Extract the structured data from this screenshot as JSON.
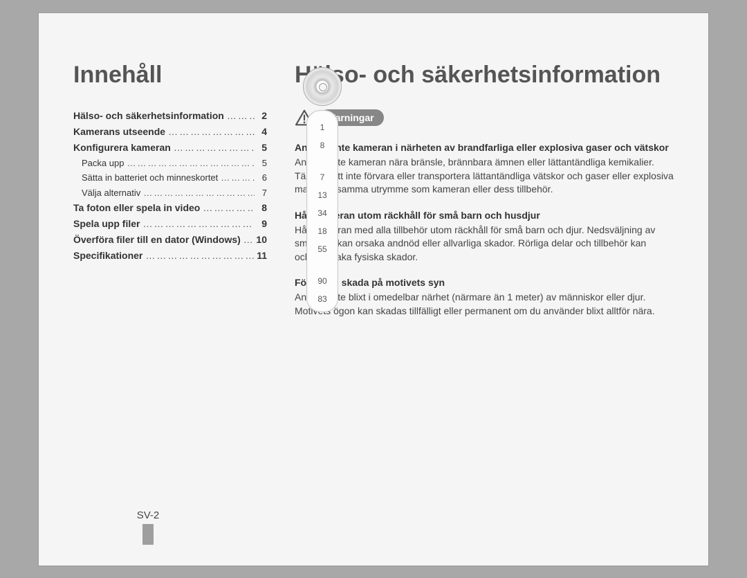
{
  "left": {
    "title": "Innehåll",
    "toc": [
      {
        "label": "Hälso- och säkerhetsinformation",
        "page": "2",
        "bold": true
      },
      {
        "label": "Kamerans utseende",
        "page": "4",
        "bold": true
      },
      {
        "label": "Konfigurera kameran",
        "page": "5",
        "bold": true
      },
      {
        "label": "Packa upp",
        "page": "5",
        "bold": false,
        "sub": true
      },
      {
        "label": "Sätta in batteriet och minneskortet",
        "page": "6",
        "bold": false,
        "sub": true
      },
      {
        "label": "Välja alternativ",
        "page": "7",
        "bold": false,
        "sub": true
      },
      {
        "label": "Ta foton eller spela in video",
        "page": "8",
        "bold": true
      },
      {
        "label": "Spela upp filer",
        "page": "9",
        "bold": true
      },
      {
        "label": "Överföra filer till en dator (Windows)",
        "page": "10",
        "bold": true
      },
      {
        "label": "Specifikationer",
        "page": "11",
        "bold": true
      }
    ],
    "footer": "SV-2"
  },
  "right": {
    "title": "Hälso- och säkerhetsinformation",
    "warning_label": "Varningar",
    "blocks": [
      {
        "heading": "Använd inte kameran i närheten av brandfarliga eller explosiva gaser och vätskor",
        "text": "Använd inte kameran nära bränsle, brännbara ämnen eller lättantändliga kemikalier. Tänk på att inte förvara eller transportera lättantändliga vätskor och gaser eller explosiva material i samma utrymme som kameran eller dess tillbehör."
      },
      {
        "heading": "Håll kameran utom räckhåll för små barn och husdjur",
        "text": "Håll kameran med alla tillbehör utom räckhåll för små barn och djur. Nedsväljning av smådelar kan orsaka andnöd eller allvarliga skador. Rörliga delar och tillbehör kan också orsaka fysiska skador."
      },
      {
        "heading": "Förebygg skada på motivets syn",
        "text": "Använd inte blixt i omedelbar närhet (närmare än 1 meter) av människor eller djur. Motivets ögon kan skadas tillfälligt eller permanent om du använder blixt alltför nära."
      }
    ]
  },
  "widget": {
    "ticks": [
      "1",
      "8",
      "",
      "7",
      "13",
      "34",
      "18",
      "55",
      "",
      "90",
      "83"
    ]
  }
}
